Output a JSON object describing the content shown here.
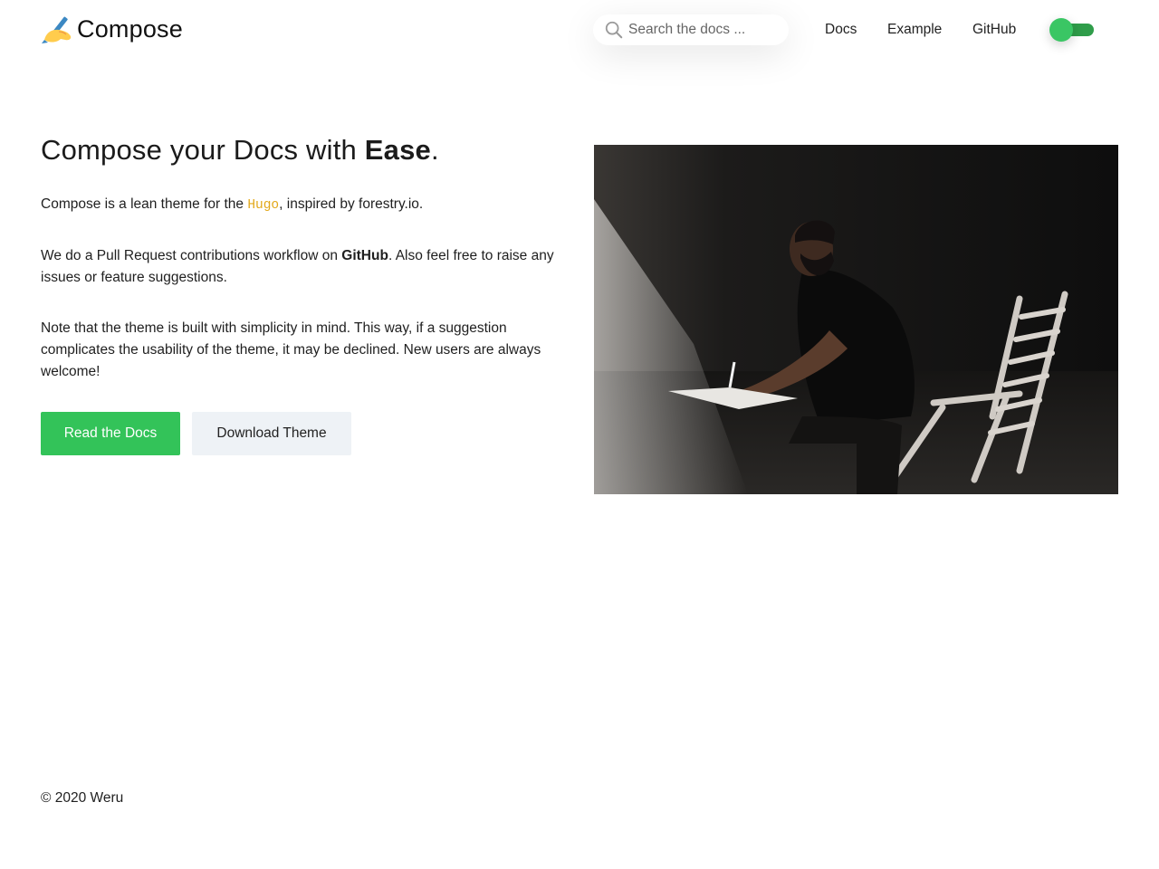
{
  "brand": {
    "name": "Compose",
    "icon": "writing-hand-icon"
  },
  "search": {
    "placeholder": "Search the docs ..."
  },
  "nav": {
    "items": [
      {
        "label": "Docs"
      },
      {
        "label": "Example"
      },
      {
        "label": "GitHub"
      }
    ]
  },
  "theme_toggle": {
    "state": "on",
    "color": "#3ac664"
  },
  "hero": {
    "title_prefix": "Compose your Docs with ",
    "title_emphasis": "Ease",
    "title_suffix": ".",
    "p1_prefix": "Compose is a lean theme for the ",
    "p1_code": "Hugo",
    "p1_suffix": ", inspired by forestry.io.",
    "p2_prefix": "We do a Pull Request contributions workflow on ",
    "p2_strong": "GitHub",
    "p2_suffix": ". Also feel free to raise any issues or feature suggestions.",
    "p3": "Note that the theme is built with simplicity in mind. This way, if a suggestion complicates the usability of the theme, it may be declined. New users are always welcome!",
    "primary_button": "Read the Docs",
    "secondary_button": "Download Theme"
  },
  "footer": {
    "copyright": "© 2020 Weru"
  },
  "colors": {
    "accent": "#33c359",
    "code": "#e2a81b",
    "secondary_button_bg": "#eef2f6"
  }
}
